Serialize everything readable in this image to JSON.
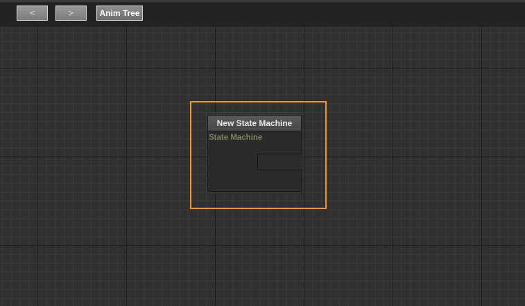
{
  "toolbar": {
    "back_icon": "back-arrow-icon",
    "back_label": "<",
    "forward_icon": "forward-arrow-icon",
    "forward_label": ">",
    "breadcrumb_label": "Anim Tree"
  },
  "canvas": {
    "node": {
      "title": "New State Machine",
      "type_label": "State Machine",
      "selected": true
    }
  },
  "colors": {
    "selection": "#f0952e",
    "type_label": "#7f7f5f",
    "canvas_background": "#303030"
  }
}
